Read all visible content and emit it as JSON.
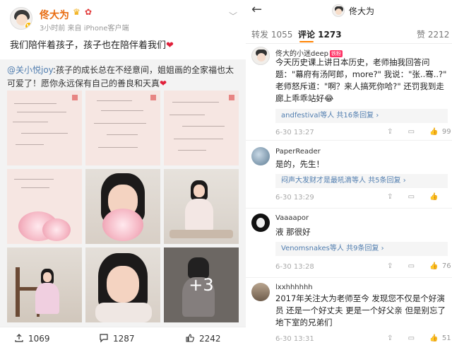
{
  "post": {
    "author": "佟大为",
    "meta": "3小时前  来自 iPhone客户端",
    "text": "我们陪伴着孩子，孩子也在陪伴着我们",
    "heart": "❤",
    "repost": {
      "mention": "@关小悦joy",
      "text": ":孩子的成长总在不经意间，姐姐画的全家福也太可爱了！愿你永远保有自己的善良和天真",
      "heart": "❤"
    },
    "more_count": "+3",
    "actions": {
      "share_count": "1069",
      "comment_count": "1287",
      "like_count": "2242"
    }
  },
  "detail": {
    "title": "佟大为",
    "tabs": {
      "repost": "转发 1055",
      "comments": "评论 1273",
      "likes": "赞 2212"
    },
    "comments": [
      {
        "name": "佟大的小迷deep",
        "badge": "铁粉",
        "text": "今天历史课上讲日本历史，老师抽我回答问题：\"幕府有汤阿郎，more?\" 我说：\"张..骞..?\" 老师怒斥道：\"啊？来人搞死你哈?\" 还罚我到走廊上乖乖站好😂",
        "reply_names": "andfestival等人",
        "reply_count": "共16条回复",
        "time": "6-30 13:27",
        "likes": "99"
      },
      {
        "name": "PaperReader",
        "text": "是的，先生！",
        "reply_names": "闷声大发财才是最吼滴等人",
        "reply_count": "共5条回复",
        "time": "6-30 13:29",
        "likes": ""
      },
      {
        "name": "Vaaaapor",
        "text": "液 那很好",
        "reply_names": "Venomsnakes等人",
        "reply_count": "共9条回复",
        "time": "6-30 13:28",
        "likes": "76"
      },
      {
        "name": "lxxhhhhhh",
        "text": "2017年关注大为老师至今 发现您不仅是个好演员 还是一个好丈夫 更是一个好父亲 但是别忘了地下室的兄弟们",
        "time": "6-30 13:31",
        "likes": "51"
      }
    ]
  }
}
